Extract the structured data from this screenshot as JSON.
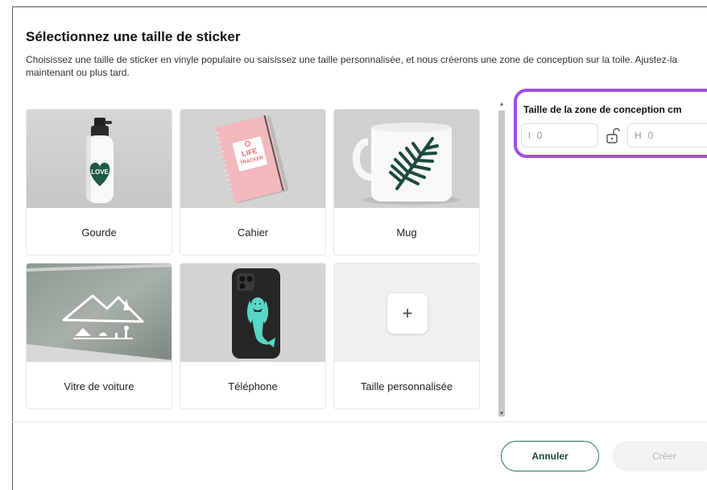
{
  "dialog": {
    "title": "Sélectionnez une taille de sticker",
    "subtitle": "Choisissez une taille de sticker en vinyle populaire ou saisissez une taille personnalisée, et nous créerons une zone de conception sur la toile. Ajustez-la maintenant ou plus tard."
  },
  "cards": [
    {
      "label": "Gourde",
      "image": "water-bottle-photo"
    },
    {
      "label": "Cahier",
      "image": "notebook-photo"
    },
    {
      "label": "Mug",
      "image": "mug-photo"
    },
    {
      "label": "Vitre de voiture",
      "image": "car-window-photo"
    },
    {
      "label": "Téléphone",
      "image": "phone-case-photo"
    },
    {
      "label": "Taille personnalisée",
      "image": "plus-icon",
      "plus": "+"
    }
  ],
  "sticker_text": {
    "bottle": "LOVE",
    "notebook_line1": "LIFE",
    "notebook_line2": "TRACKER"
  },
  "side_panel": {
    "title": "Taille de la zone de conception cm",
    "width_prefix": "l",
    "width_value": "0",
    "height_prefix": "H",
    "height_value": "0",
    "lock_icon": "unlocked-padlock-icon"
  },
  "footer": {
    "cancel_label": "Annuler",
    "create_label": "Créer"
  },
  "colors": {
    "accent_green": "#1f7a5a",
    "highlight_purple": "#a24de3",
    "disabled_bg": "#f2f2f2"
  }
}
